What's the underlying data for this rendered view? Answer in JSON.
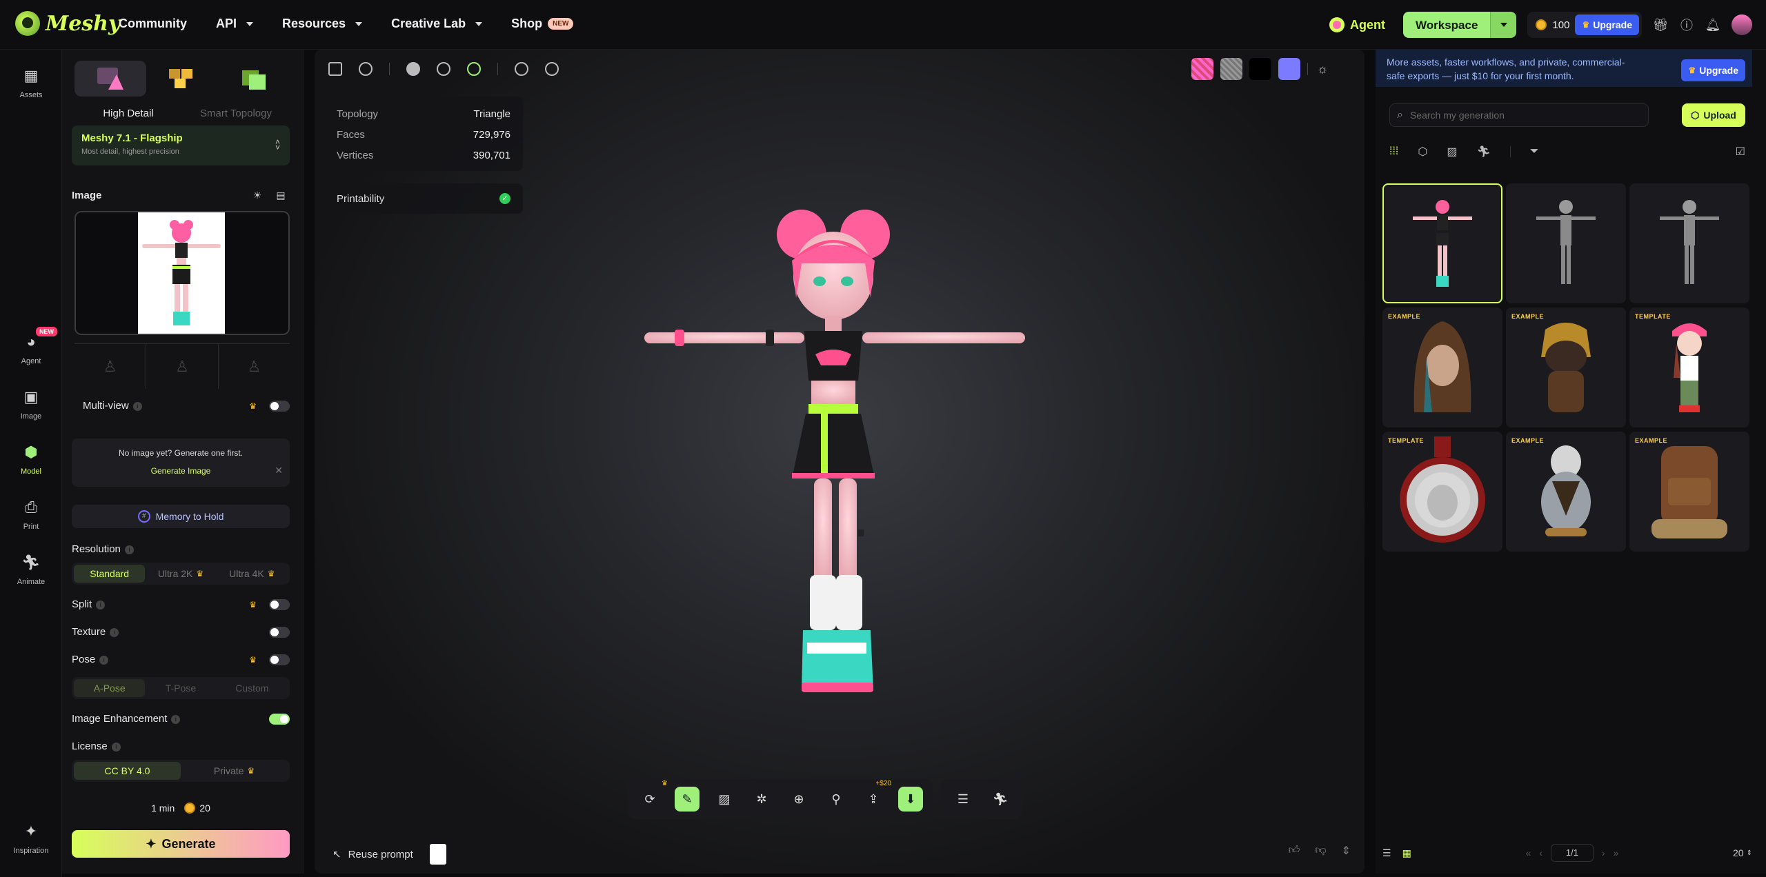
{
  "header": {
    "brand": "Meshy",
    "nav": [
      {
        "label": "Community",
        "caret": false
      },
      {
        "label": "API",
        "caret": true
      },
      {
        "label": "Resources",
        "caret": true
      },
      {
        "label": "Creative Lab",
        "caret": true
      },
      {
        "label": "Shop",
        "caret": false,
        "badge": "NEW"
      }
    ],
    "agent_label": "Agent",
    "workspace_label": "Workspace",
    "credits": "100",
    "upgrade_label": "Upgrade"
  },
  "rail": {
    "items": [
      {
        "label": "Assets",
        "icon": "grid-icon"
      },
      {
        "label": "Agent",
        "icon": "agent-icon",
        "badge": "NEW"
      },
      {
        "label": "Image",
        "icon": "image-icon"
      },
      {
        "label": "Model",
        "icon": "cube-icon",
        "active": true
      },
      {
        "label": "Print",
        "icon": "printer-icon"
      },
      {
        "label": "Animate",
        "icon": "running-icon"
      }
    ],
    "bottom": "Inspiration"
  },
  "panel": {
    "modes": [
      "High Detail",
      "Smart Topology"
    ],
    "model_name": "Meshy 7.1 - Flagship",
    "model_sub": "Most detail, highest precision",
    "image_label": "Image",
    "multiview_label": "Multi-view",
    "hint_text": "No image yet? Generate one first.",
    "hint_link": "Generate Image",
    "memory_label": "Memory to Hold",
    "resolution_label": "Resolution",
    "resolution_options": [
      "Standard",
      "Ultra 2K",
      "Ultra 4K"
    ],
    "split_label": "Split",
    "texture_label": "Texture",
    "pose_label": "Pose",
    "pose_options": [
      "A-Pose",
      "T-Pose",
      "Custom"
    ],
    "enhance_label": "Image Enhancement",
    "license_label": "License",
    "license_options": [
      "CC BY 4.0",
      "Private"
    ],
    "time": "1 min",
    "cost": "20",
    "generate_label": "Generate"
  },
  "viewport": {
    "stats": [
      {
        "k": "Topology",
        "v": "Triangle"
      },
      {
        "k": "Faces",
        "v": "729,976"
      },
      {
        "k": "Vertices",
        "v": "390,701"
      }
    ],
    "printability_label": "Printability",
    "reuse_label": "Reuse prompt",
    "price_tag": "+$20"
  },
  "right": {
    "promo": "More assets, faster workflows, and private, commercial-safe exports — just $10 for your first month.",
    "upgrade_label": "Upgrade",
    "search_placeholder": "Search my generation",
    "upload_label": "Upload",
    "cards": [
      {
        "tag": "",
        "kind": "girl"
      },
      {
        "tag": "",
        "kind": "gray"
      },
      {
        "tag": "",
        "kind": "gray"
      },
      {
        "tag": "EXAMPLE",
        "kind": "hood"
      },
      {
        "tag": "EXAMPLE",
        "kind": "dog"
      },
      {
        "tag": "TEMPLATE",
        "kind": "chibi"
      },
      {
        "tag": "TEMPLATE",
        "kind": "medal"
      },
      {
        "tag": "EXAMPLE",
        "kind": "bird"
      },
      {
        "tag": "EXAMPLE",
        "kind": "bag"
      }
    ],
    "page": "1/1",
    "page_size": "20"
  }
}
